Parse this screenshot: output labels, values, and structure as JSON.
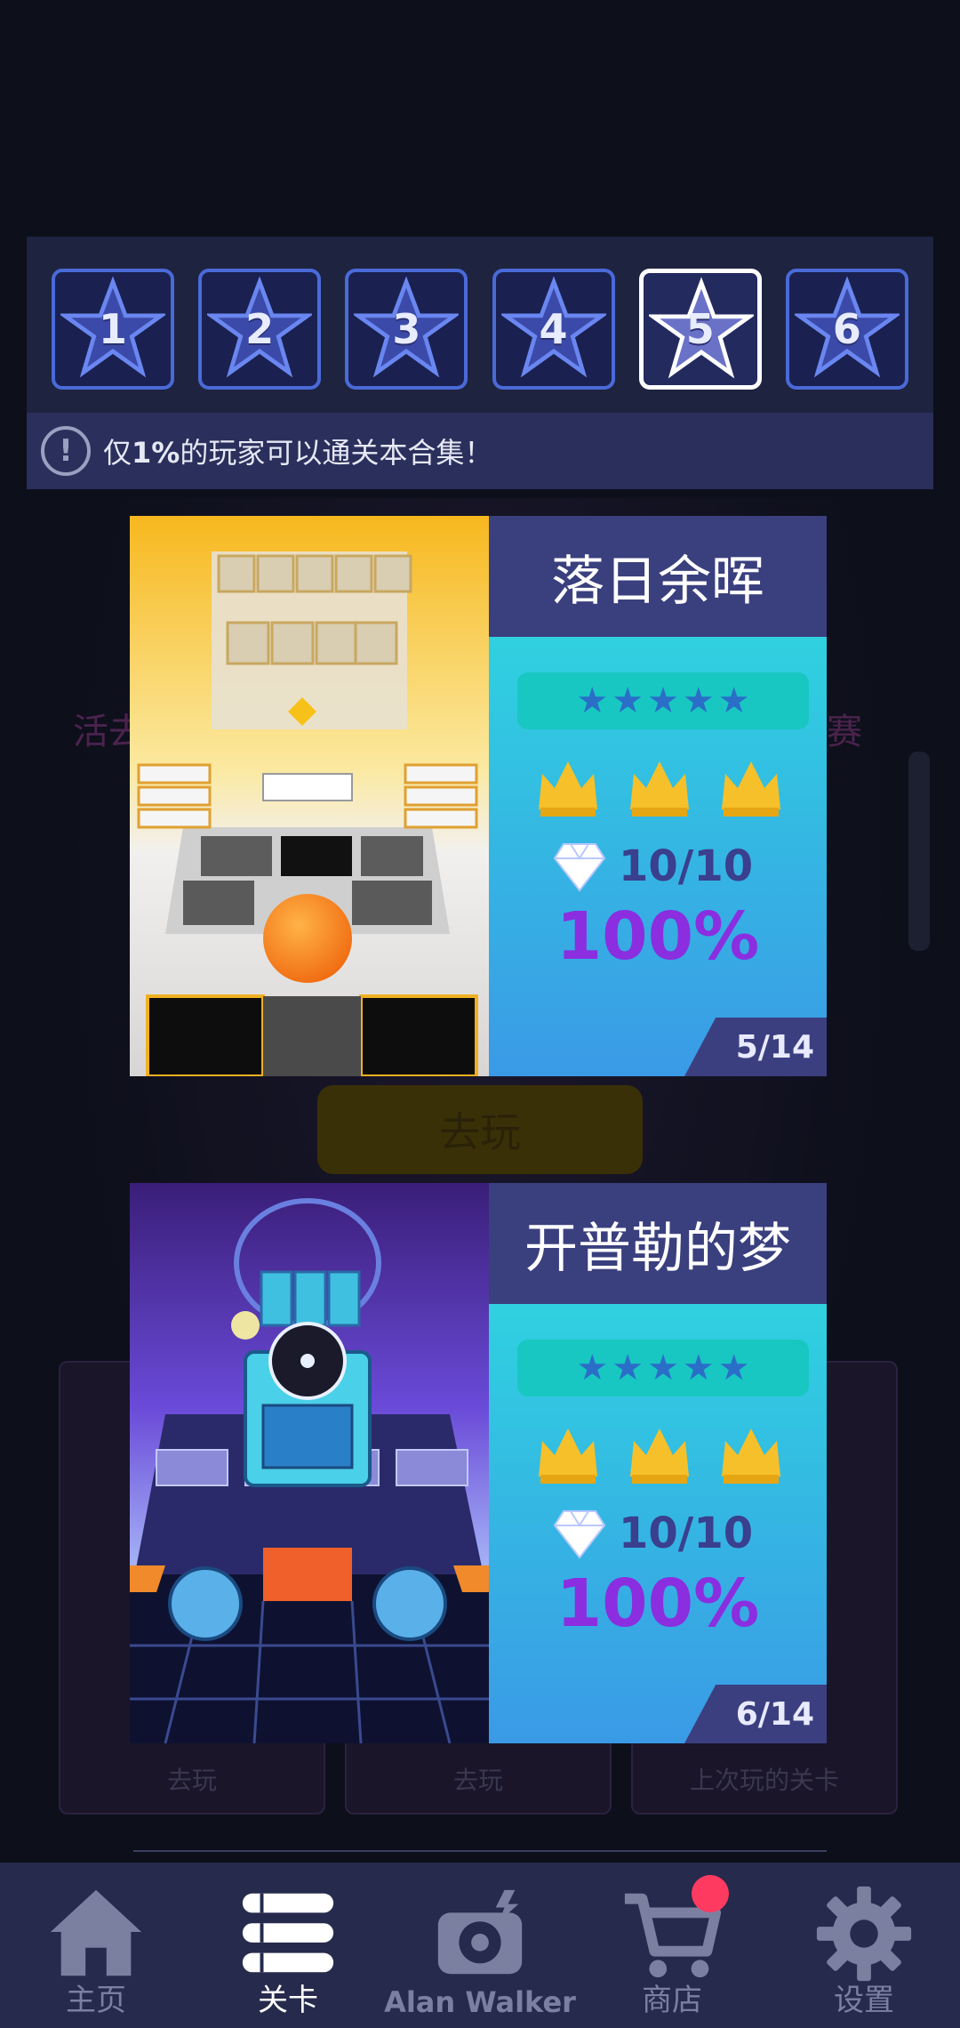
{
  "background": {
    "hint_left": "活去",
    "hint_right": "赛",
    "hint_button": "去玩",
    "hint_cards": [
      "去玩",
      "去玩",
      "上次玩的关卡"
    ]
  },
  "level_selector": {
    "tiles": [
      "1",
      "2",
      "3",
      "4",
      "5",
      "6"
    ],
    "selected": "5"
  },
  "notice": {
    "icon": "exclamation-circle-icon",
    "prefix": "仅",
    "highlight": "1%",
    "suffix": "的玩家可以通关本合集！"
  },
  "cards": [
    {
      "title": "落日余晖",
      "stars": 5,
      "crowns": 3,
      "gems": "10/10",
      "percent": "100%",
      "page": "5/14"
    },
    {
      "title": "开普勒的梦",
      "stars": 5,
      "crowns": 3,
      "gems": "10/10",
      "percent": "100%",
      "page": "6/14"
    }
  ],
  "nav": {
    "items": [
      {
        "label": "主页",
        "icon": "home-icon"
      },
      {
        "label": "关卡",
        "icon": "list-icon"
      },
      {
        "label": "Alan Walker",
        "icon": "music-player-icon"
      },
      {
        "label": "商店",
        "icon": "cart-icon"
      },
      {
        "label": "设置",
        "icon": "gear-icon"
      }
    ],
    "active": "关卡"
  },
  "colors": {
    "accent_border": "#4a6ad8",
    "card_gradient_top": "#2fd2e0",
    "card_gradient_bottom": "#3a9ae6",
    "percent": "#8a2ee0",
    "badge": "#ff3a60"
  }
}
